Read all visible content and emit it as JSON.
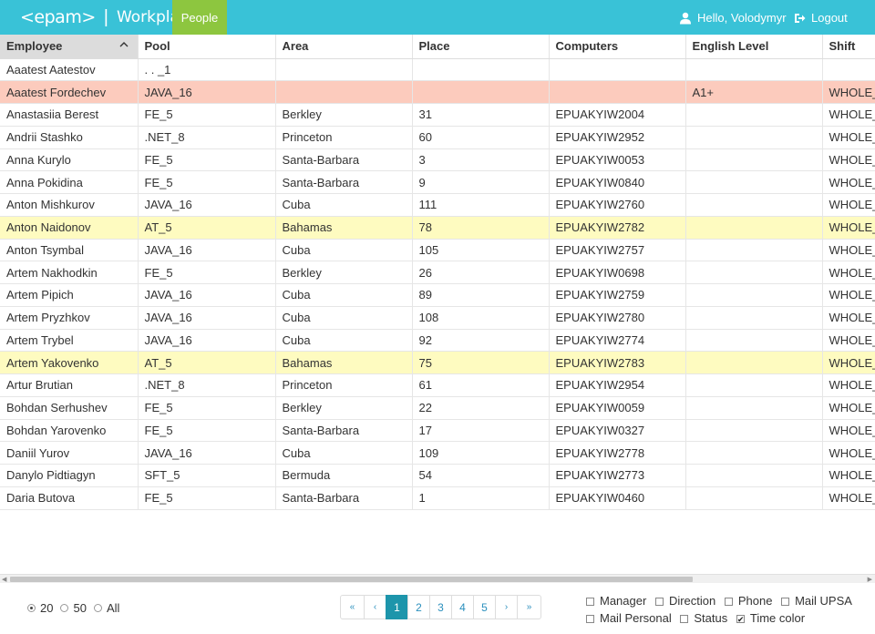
{
  "header": {
    "logo": "<epam>",
    "app_name": "Workplaces",
    "nav_people": "People",
    "greeting": "Hello, Volodymyr",
    "logout": "Logout",
    "colors": {
      "bar": "#39c2d7",
      "nav_active": "#8dc63f"
    }
  },
  "table": {
    "columns": [
      "Employee",
      "Pool",
      "Area",
      "Place",
      "Computers",
      "English Level",
      "Shift"
    ],
    "sorted_column": "Employee",
    "sort_direction": "ascending",
    "rows": [
      {
        "cells": [
          "Aaatest Aatestov",
          ". . _1",
          "",
          "",
          "",
          "",
          ""
        ],
        "highlight": ""
      },
      {
        "cells": [
          "Aaatest Fordechev",
          "JAVA_16",
          "",
          "",
          "",
          "A1+",
          "WHOLE_"
        ],
        "highlight": "pink"
      },
      {
        "cells": [
          "Anastasiia Berest",
          "FE_5",
          "Berkley",
          "31",
          "EPUAKYIW2004",
          "",
          "WHOLE_"
        ],
        "highlight": ""
      },
      {
        "cells": [
          "Andrii Stashko",
          ".NET_8",
          "Princeton",
          "60",
          "EPUAKYIW2952",
          "",
          "WHOLE_"
        ],
        "highlight": ""
      },
      {
        "cells": [
          "Anna Kurylo",
          "FE_5",
          "Santa-Barbara",
          "3",
          "EPUAKYIW0053",
          "",
          "WHOLE_"
        ],
        "highlight": ""
      },
      {
        "cells": [
          "Anna Pokidina",
          "FE_5",
          "Santa-Barbara",
          "9",
          "EPUAKYIW0840",
          "",
          "WHOLE_"
        ],
        "highlight": ""
      },
      {
        "cells": [
          "Anton Mishkurov",
          "JAVA_16",
          "Cuba",
          "111",
          "EPUAKYIW2760",
          "",
          "WHOLE_"
        ],
        "highlight": ""
      },
      {
        "cells": [
          "Anton Naidonov",
          "AT_5",
          "Bahamas",
          "78",
          "EPUAKYIW2782",
          "",
          "WHOLE_"
        ],
        "highlight": "yellow"
      },
      {
        "cells": [
          "Anton Tsymbal",
          "JAVA_16",
          "Cuba",
          "105",
          "EPUAKYIW2757",
          "",
          "WHOLE_"
        ],
        "highlight": ""
      },
      {
        "cells": [
          "Artem Nakhodkin",
          "FE_5",
          "Berkley",
          "26",
          "EPUAKYIW0698",
          "",
          "WHOLE_"
        ],
        "highlight": ""
      },
      {
        "cells": [
          "Artem Pipich",
          "JAVA_16",
          "Cuba",
          "89",
          "EPUAKYIW2759",
          "",
          "WHOLE_"
        ],
        "highlight": ""
      },
      {
        "cells": [
          "Artem Pryzhkov",
          "JAVA_16",
          "Cuba",
          "108",
          "EPUAKYIW2780",
          "",
          "WHOLE_"
        ],
        "highlight": ""
      },
      {
        "cells": [
          "Artem Trybel",
          "JAVA_16",
          "Cuba",
          "92",
          "EPUAKYIW2774",
          "",
          "WHOLE_"
        ],
        "highlight": ""
      },
      {
        "cells": [
          "Artem Yakovenko",
          "AT_5",
          "Bahamas",
          "75",
          "EPUAKYIW2783",
          "",
          "WHOLE_"
        ],
        "highlight": "yellow"
      },
      {
        "cells": [
          "Artur Brutian",
          ".NET_8",
          "Princeton",
          "61",
          "EPUAKYIW2954",
          "",
          "WHOLE_"
        ],
        "highlight": ""
      },
      {
        "cells": [
          "Bohdan Serhushev",
          "FE_5",
          "Berkley",
          "22",
          "EPUAKYIW0059",
          "",
          "WHOLE_"
        ],
        "highlight": ""
      },
      {
        "cells": [
          "Bohdan Yarovenko",
          "FE_5",
          "Santa-Barbara",
          "17",
          "EPUAKYIW0327",
          "",
          "WHOLE_"
        ],
        "highlight": ""
      },
      {
        "cells": [
          "Daniil Yurov",
          "JAVA_16",
          "Cuba",
          "109",
          "EPUAKYIW2778",
          "",
          "WHOLE_"
        ],
        "highlight": ""
      },
      {
        "cells": [
          "Danylo Pidtiagyn",
          "SFT_5",
          "Bermuda",
          "54",
          "EPUAKYIW2773",
          "",
          "WHOLE_"
        ],
        "highlight": ""
      },
      {
        "cells": [
          "Daria Butova",
          "FE_5",
          "Santa-Barbara",
          "1",
          "EPUAKYIW0460",
          "",
          "WHOLE_"
        ],
        "highlight": ""
      }
    ]
  },
  "page_size": {
    "options": [
      "20",
      "50",
      "All"
    ],
    "selected": "20"
  },
  "pagination": {
    "first": "«",
    "prev": "‹",
    "pages": [
      "1",
      "2",
      "3",
      "4",
      "5"
    ],
    "current": "1",
    "next": "›",
    "last": "»"
  },
  "column_toggles": [
    {
      "label": "Manager",
      "checked": false
    },
    {
      "label": "Direction",
      "checked": false
    },
    {
      "label": "Phone",
      "checked": false
    },
    {
      "label": "Mail UPSA",
      "checked": false
    },
    {
      "label": "Mail Personal",
      "checked": false
    },
    {
      "label": "Status",
      "checked": false
    },
    {
      "label": "Time color",
      "checked": true
    }
  ]
}
